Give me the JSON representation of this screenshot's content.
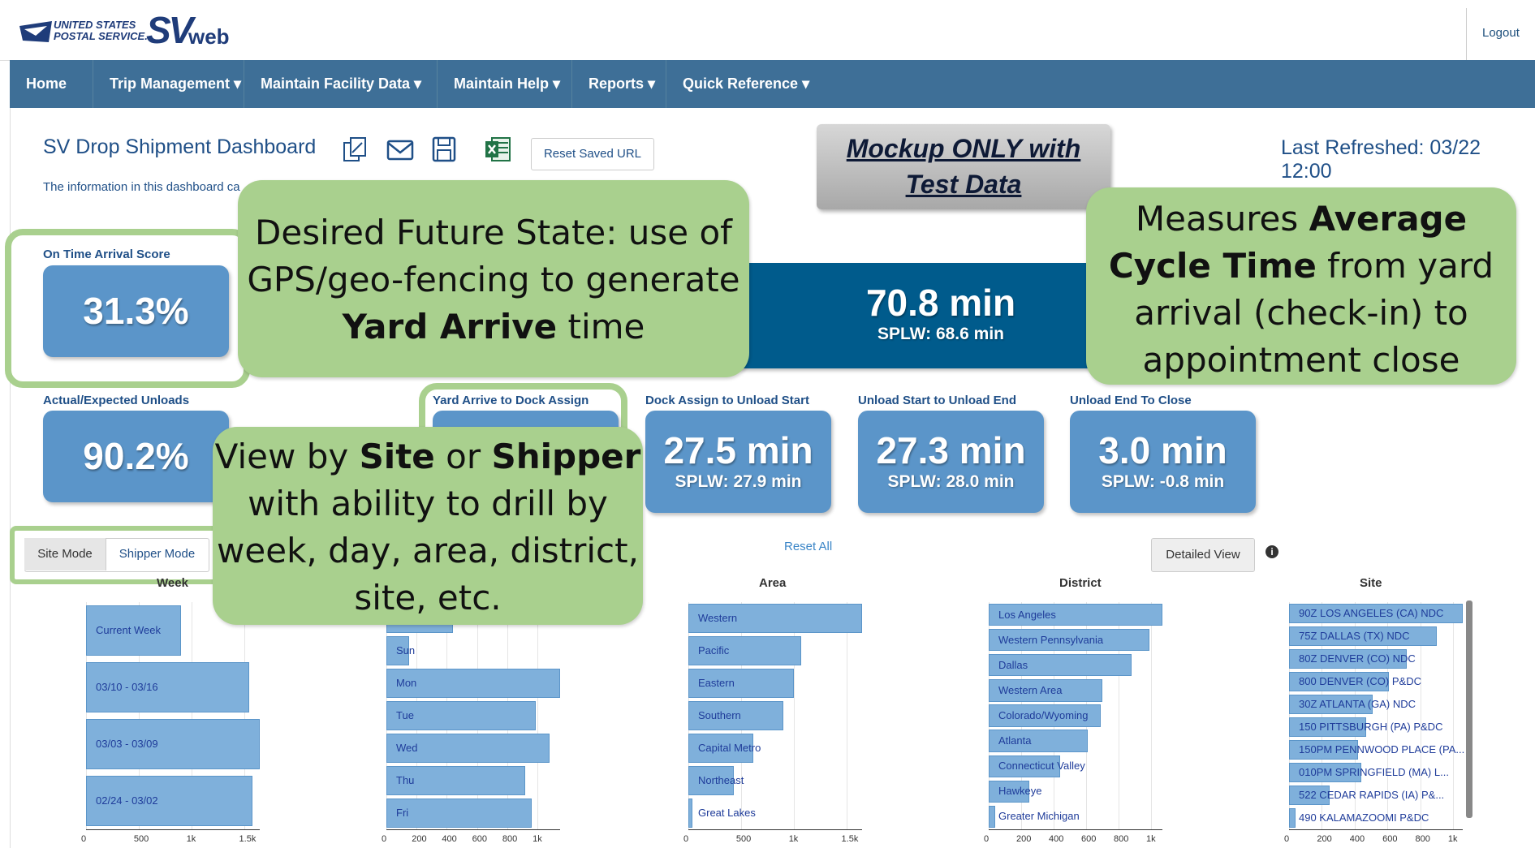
{
  "header": {
    "logo_text_line1": "UNITED STATES",
    "logo_text_line2": "POSTAL SERVICE.",
    "logo_sv": "SV",
    "logo_web": "web",
    "logout": "Logout"
  },
  "nav": {
    "items": [
      {
        "label": "Home"
      },
      {
        "label": "Trip Management ▾"
      },
      {
        "label": "Maintain Facility Data ▾"
      },
      {
        "label": "Maintain Help ▾"
      },
      {
        "label": "Reports ▾"
      },
      {
        "label": "Quick Reference ▾"
      }
    ]
  },
  "dashboard": {
    "title": "SV Drop Shipment Dashboard",
    "subtitle": "The information in this dashboard ca",
    "reset_saved_url": "Reset Saved URL",
    "last_refreshed": "Last Refreshed: 03/22 12:00",
    "mockup_line1": "Mockup ONLY with",
    "mockup_line2": "Test Data"
  },
  "kpis": {
    "on_time": {
      "label": "On Time Arrival Score",
      "value": "31.3%"
    },
    "avg_cycle": {
      "value": "70.8 min",
      "splw": "SPLW: 68.6 min"
    },
    "actual_expected": {
      "label": "Actual/Expected Unloads",
      "value": "90.2%"
    },
    "yard_to_dock": {
      "label": "Yard Arrive to Dock Assign"
    },
    "dock_to_unload": {
      "label": "Dock Assign to Unload Start",
      "value": "27.5 min",
      "splw": "SPLW: 27.9 min"
    },
    "unload_start_end": {
      "label": "Unload Start to Unload End",
      "value": "27.3 min",
      "splw": "SPLW: 28.0 min"
    },
    "unload_end_close": {
      "label": "Unload End To Close",
      "value": "3.0 min",
      "splw": "SPLW: -0.8 min"
    }
  },
  "callouts": {
    "future_state": {
      "pre": "Desired Future State:  use of GPS/geo-fencing to generate ",
      "bold": "Yard Arrive",
      "post": " time"
    },
    "measures": {
      "pre": "Measures ",
      "bold": "Average Cycle Time",
      "post": " from yard arrival (check-in) to appointment close"
    },
    "view_by": {
      "pre": "View by ",
      "bold1": "Site",
      "mid": " or ",
      "bold2": "Shipper",
      "post": " with ability to drill by week, day, area, district, site, etc."
    }
  },
  "controls": {
    "site_mode": "Site Mode",
    "shipper_mode": "Shipper Mode",
    "reset_all": "Reset All",
    "detailed_view": "Detailed View",
    "info_glyph": "i"
  },
  "chart_data": [
    {
      "type": "bar",
      "title": "Week",
      "orientation": "horizontal",
      "categories": [
        "Current Week",
        "03/10 - 03/16",
        "03/03 - 03/09",
        "02/24 - 03/02"
      ],
      "values": [
        900,
        1550,
        1650,
        1580
      ],
      "xlim": [
        0,
        1650
      ],
      "ticks": [
        "0",
        "500",
        "1k",
        "1.5k"
      ],
      "tick_values": [
        0,
        500,
        1000,
        1500
      ]
    },
    {
      "type": "bar",
      "title": "",
      "orientation": "horizontal",
      "categories": [
        "",
        "Sun",
        "Mon",
        "Tue",
        "Wed",
        "Thu",
        "Fri"
      ],
      "values": [
        440,
        150,
        1150,
        990,
        1080,
        920,
        960
      ],
      "xlim": [
        0,
        1150
      ],
      "ticks": [
        "0",
        "200",
        "400",
        "600",
        "800",
        "1k"
      ],
      "tick_values": [
        0,
        200,
        400,
        600,
        800,
        1000
      ]
    },
    {
      "type": "bar",
      "title": "Area",
      "orientation": "horizontal",
      "categories": [
        "Western",
        "Pacific",
        "Eastern",
        "Southern",
        "Capital Metro",
        "Northeast",
        "Great Lakes"
      ],
      "values": [
        1650,
        1070,
        1000,
        900,
        620,
        430,
        40
      ],
      "xlim": [
        0,
        1650
      ],
      "ticks": [
        "0",
        "500",
        "1k",
        "1.5k"
      ],
      "tick_values": [
        0,
        500,
        1000,
        1500
      ]
    },
    {
      "type": "bar",
      "title": "District",
      "orientation": "horizontal",
      "categories": [
        "Los Angeles",
        "Western Pennsylvania",
        "Dallas",
        "Western Area",
        "Colorado/Wyoming",
        "Atlanta",
        "Connecticut Valley",
        "Hawkeye",
        "Greater Michigan"
      ],
      "values": [
        1070,
        990,
        880,
        700,
        690,
        610,
        440,
        250,
        40
      ],
      "xlim": [
        0,
        1070
      ],
      "ticks": [
        "0",
        "200",
        "400",
        "600",
        "800",
        "1k"
      ],
      "tick_values": [
        0,
        200,
        400,
        600,
        800,
        1000
      ]
    },
    {
      "type": "bar",
      "title": "Site",
      "orientation": "horizontal",
      "categories": [
        "90Z LOS ANGELES (CA) NDC",
        "75Z DALLAS (TX) NDC",
        "80Z DENVER (CO) NDC",
        "800 DENVER (CO) P&DC",
        "30Z ATLANTA (GA) NDC",
        "150 PITTSBURGH (PA) P&DC",
        "150PM PENNWOOD PLACE (PA...",
        "010PM SPRINGFIELD (MA) L...",
        "522 CEDAR RAPIDS (IA) P&...",
        "490 KALAMAZOOMI P&DC"
      ],
      "values": [
        1060,
        900,
        720,
        610,
        510,
        470,
        420,
        440,
        250,
        40
      ],
      "xlim": [
        0,
        1060
      ],
      "ticks": [
        "0",
        "200",
        "400",
        "600",
        "800",
        "1k"
      ],
      "tick_values": [
        0,
        200,
        400,
        600,
        800,
        1000
      ]
    }
  ]
}
